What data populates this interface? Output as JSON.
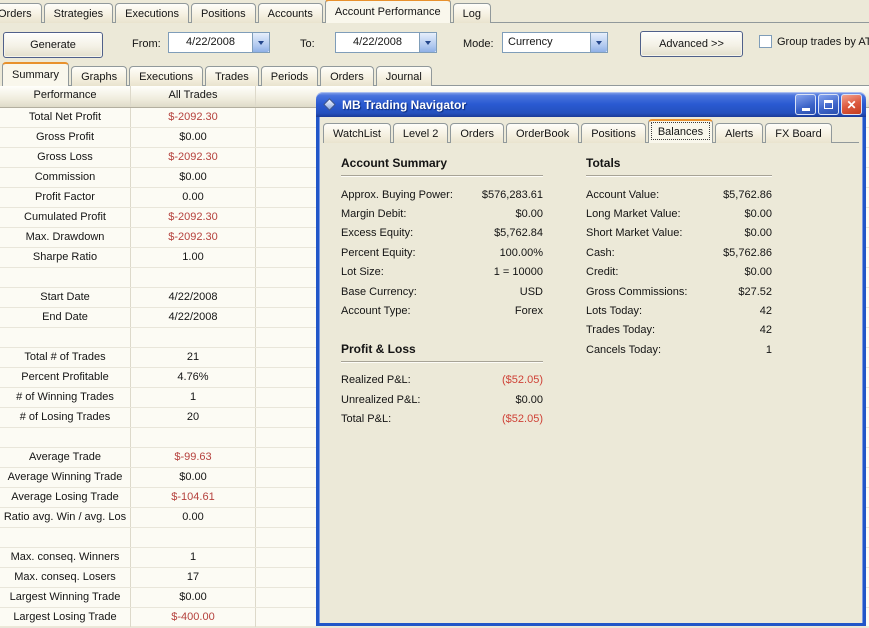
{
  "app": {
    "main_tabs": [
      {
        "label": "Orders"
      },
      {
        "label": "Strategies"
      },
      {
        "label": "Executions"
      },
      {
        "label": "Positions"
      },
      {
        "label": "Accounts"
      },
      {
        "label": "Account Performance",
        "active": true
      },
      {
        "label": "Log"
      }
    ],
    "toolbar": {
      "generate": "Generate",
      "from_label": "From:",
      "from_value": "4/22/2008",
      "to_label": "To:",
      "to_value": "4/22/2008",
      "mode_label": "Mode:",
      "mode_value": "Currency",
      "advanced": "Advanced >>",
      "group_trades_label": "Group trades by AT",
      "group_trades_checked": false
    },
    "sub_tabs": [
      {
        "label": "Summary",
        "active": true
      },
      {
        "label": "Graphs"
      },
      {
        "label": "Executions"
      },
      {
        "label": "Trades"
      },
      {
        "label": "Periods"
      },
      {
        "label": "Orders"
      },
      {
        "label": "Journal"
      }
    ]
  },
  "performance_table": {
    "columns": [
      "Performance",
      "All Trades"
    ],
    "rows": [
      {
        "label": "Total Net Profit",
        "value": "$-2092.30",
        "negative": true
      },
      {
        "label": "Gross Profit",
        "value": "$0.00"
      },
      {
        "label": "Gross Loss",
        "value": "$-2092.30",
        "negative": true
      },
      {
        "label": "Commission",
        "value": "$0.00"
      },
      {
        "label": "Profit Factor",
        "value": "0.00"
      },
      {
        "label": "Cumulated Profit",
        "value": "$-2092.30",
        "negative": true
      },
      {
        "label": "Max. Drawdown",
        "value": "$-2092.30",
        "negative": true
      },
      {
        "label": "Sharpe Ratio",
        "value": "1.00"
      },
      {
        "label": "",
        "value": ""
      },
      {
        "label": "Start Date",
        "value": "4/22/2008"
      },
      {
        "label": "End Date",
        "value": "4/22/2008"
      },
      {
        "label": "",
        "value": ""
      },
      {
        "label": "Total # of Trades",
        "value": "21"
      },
      {
        "label": "Percent Profitable",
        "value": "4.76%"
      },
      {
        "label": "# of Winning Trades",
        "value": "1"
      },
      {
        "label": "# of Losing Trades",
        "value": "20"
      },
      {
        "label": "",
        "value": ""
      },
      {
        "label": "Average Trade",
        "value": "$-99.63",
        "negative": true
      },
      {
        "label": "Average Winning Trade",
        "value": "$0.00"
      },
      {
        "label": "Average Losing Trade",
        "value": "$-104.61",
        "negative": true
      },
      {
        "label": "Ratio avg. Win / avg. Los",
        "value": "0.00"
      },
      {
        "label": "",
        "value": ""
      },
      {
        "label": "Max. conseq. Winners",
        "value": "1"
      },
      {
        "label": "Max. conseq. Losers",
        "value": "17"
      },
      {
        "label": "Largest Winning Trade",
        "value": "$0.00"
      },
      {
        "label": "Largest Losing Trade",
        "value": "$-400.00",
        "negative": true
      }
    ]
  },
  "navigator": {
    "title": "MB Trading Navigator",
    "tabs": [
      {
        "label": "WatchList"
      },
      {
        "label": "Level 2"
      },
      {
        "label": "Orders"
      },
      {
        "label": "OrderBook"
      },
      {
        "label": "Positions"
      },
      {
        "label": "Balances",
        "active": true
      },
      {
        "label": "Alerts"
      },
      {
        "label": "FX Board"
      }
    ],
    "account_summary": {
      "title": "Account Summary",
      "rows": [
        {
          "label": "Approx. Buying Power:",
          "value": "$576,283.61"
        },
        {
          "label": "Margin Debit:",
          "value": "$0.00"
        },
        {
          "label": "Excess Equity:",
          "value": "$5,762.84"
        },
        {
          "label": "Percent Equity:",
          "value": "100.00%"
        },
        {
          "label": "Lot Size:",
          "value": "1 = 10000"
        },
        {
          "label": "Base Currency:",
          "value": "USD"
        },
        {
          "label": "Account Type:",
          "value": "Forex"
        }
      ]
    },
    "profit_loss": {
      "title": "Profit & Loss",
      "rows": [
        {
          "label": "Realized P&L:",
          "value": "($52.05)",
          "negative": true
        },
        {
          "label": "Unrealized P&L:",
          "value": "$0.00"
        },
        {
          "label": "Total P&L:",
          "value": "($52.05)",
          "negative": true
        }
      ]
    },
    "totals": {
      "title": "Totals",
      "rows": [
        {
          "label": "Account Value:",
          "value": "$5,762.86"
        },
        {
          "label": "Long Market Value:",
          "value": "$0.00"
        },
        {
          "label": "Short Market Value:",
          "value": "$0.00"
        },
        {
          "label": "Cash:",
          "value": "$5,762.86"
        },
        {
          "label": "Credit:",
          "value": "$0.00"
        },
        {
          "label": "Gross Commissions:",
          "value": "$27.52"
        },
        {
          "label": "Lots Today:",
          "value": "42"
        },
        {
          "label": "Trades Today:",
          "value": "42"
        },
        {
          "label": "Cancels Today:",
          "value": "1"
        }
      ]
    }
  },
  "colors": {
    "background_beige": "#ece9d8",
    "negative_table_red": "#b5413d",
    "negative_navigator_red": "#cf4237",
    "active_tab_orange": "#e8912d",
    "titlebar_blue": "#2a5ad2",
    "window_border_blue": "#2156c8"
  }
}
